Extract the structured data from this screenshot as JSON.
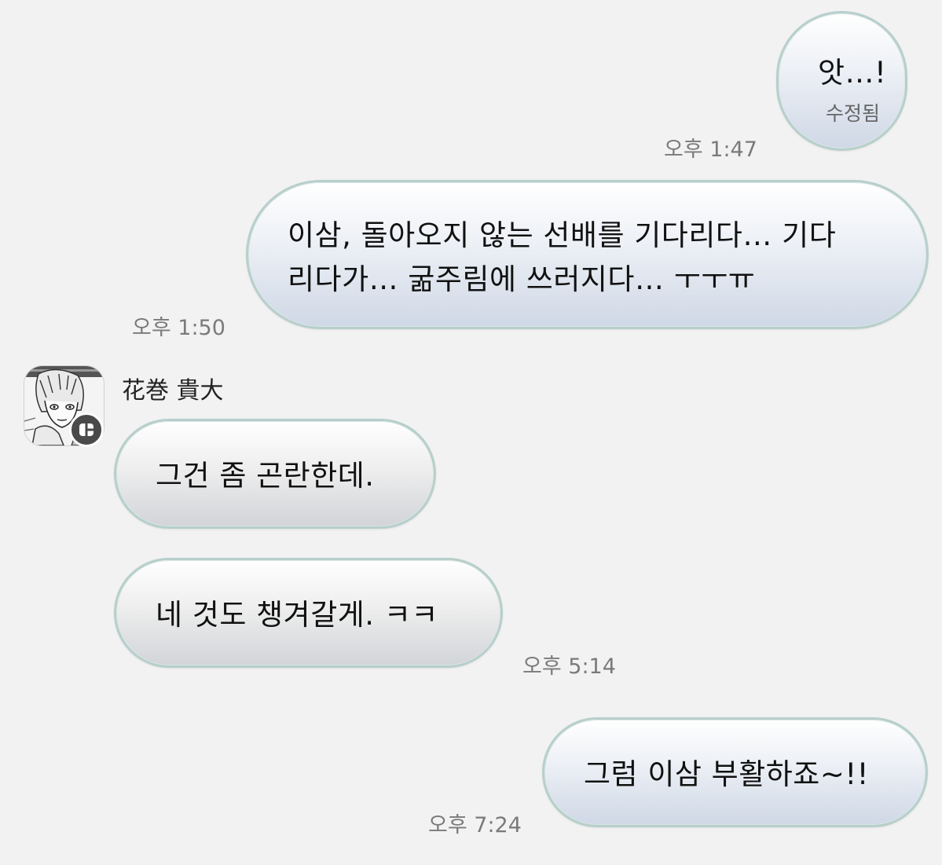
{
  "messages": [
    {
      "id": "m1",
      "direction": "outgoing",
      "text": "앗…!",
      "edited_label": "수정됨",
      "time": "오후 1:47"
    },
    {
      "id": "m2",
      "direction": "outgoing",
      "lines": [
        "이삼, 돌아오지 않는 선배를 기다리다… 기다",
        "리다가… 굶주림에 쓰러지다… ㅜㅜㅠ"
      ],
      "time": "오후 1:50"
    },
    {
      "id": "m3",
      "direction": "incoming",
      "sender": "花巻 貴大",
      "text": "그건 좀 곤란한데."
    },
    {
      "id": "m4",
      "direction": "incoming",
      "text": "네 것도 챙겨갈게. ㅋㅋ",
      "time": "오후 5:14"
    },
    {
      "id": "m5",
      "direction": "outgoing",
      "text": "그럼 이삼 부활하죠~!!",
      "time": "오후 7:24"
    }
  ],
  "colors": {
    "background": "#f2f2f2",
    "bubble_border": "#b7cfcb",
    "outgoing_bubble_bottom": "#cfd8e6",
    "incoming_bubble_bottom": "#d2d4d8",
    "timestamp": "#7a7a7a"
  },
  "icons": {
    "avatar": "manga-style-portrait-avatar",
    "avatar_badge": "chat-badge-icon"
  }
}
